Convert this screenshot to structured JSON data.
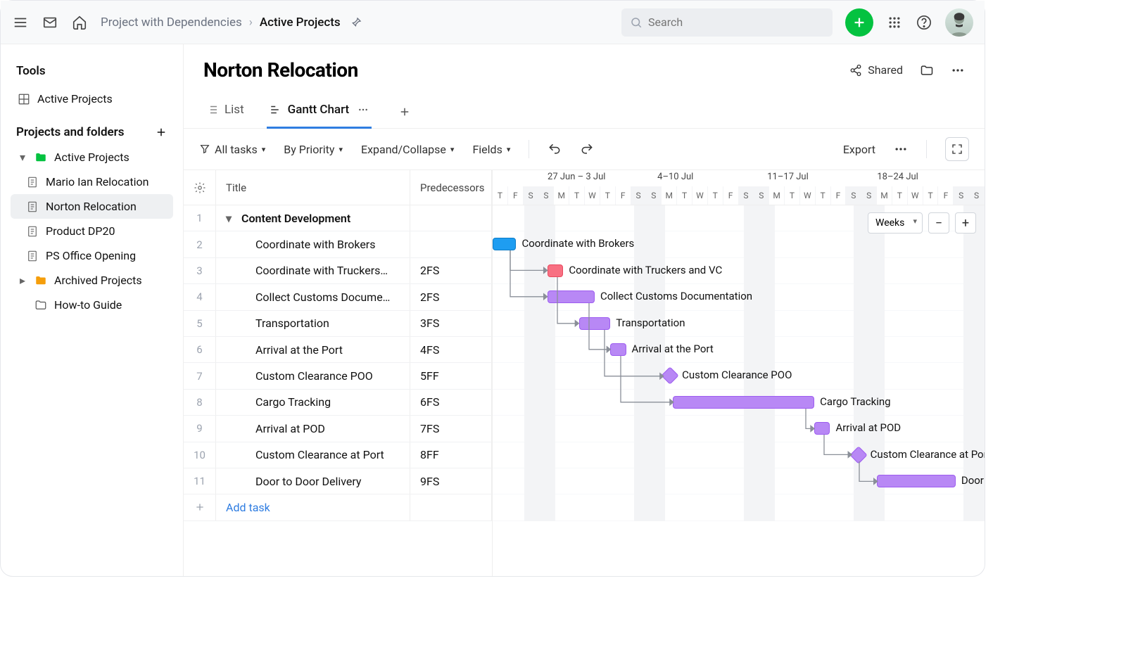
{
  "topbar": {
    "breadcrumb_parent": "Project with Dependencies",
    "breadcrumb_current": "Active Projects",
    "search_placeholder": "Search"
  },
  "sidebar": {
    "tools_header": "Tools",
    "tools_item": "Active Projects",
    "projects_header": "Projects and folders",
    "items": [
      {
        "label": "Active Projects",
        "type": "folder-green",
        "expanded": true
      },
      {
        "label": "Mario Ian Relocation",
        "type": "doc",
        "child": true
      },
      {
        "label": "Norton Relocation",
        "type": "doc",
        "child": true,
        "selected": true
      },
      {
        "label": "Product DP20",
        "type": "doc",
        "child": true
      },
      {
        "label": "PS Office Opening",
        "type": "doc",
        "child": true
      },
      {
        "label": "Archived Projects",
        "type": "folder-orange",
        "collapsed": true
      },
      {
        "label": "How-to Guide",
        "type": "folder-plain"
      }
    ]
  },
  "header": {
    "title": "Norton Relocation",
    "shared_label": "Shared",
    "tabs": {
      "list": "List",
      "gantt": "Gantt Chart"
    }
  },
  "toolbar": {
    "all_tasks": "All tasks",
    "by_priority": "By Priority",
    "expand": "Expand/Collapse",
    "fields": "Fields",
    "export": "Export"
  },
  "grid": {
    "col_title": "Title",
    "col_pred": "Predecessors",
    "add_task": "Add task",
    "rows": [
      {
        "n": "1",
        "title": "Content Development",
        "pred": "",
        "group": true
      },
      {
        "n": "2",
        "title": "Coordinate with Brokers",
        "pred": ""
      },
      {
        "n": "3",
        "title": "Coordinate with Truckers…",
        "pred": "2FS"
      },
      {
        "n": "4",
        "title": "Collect Customs Docume…",
        "pred": "2FS"
      },
      {
        "n": "5",
        "title": "Transportation",
        "pred": "3FS"
      },
      {
        "n": "6",
        "title": "Arrival at the Port",
        "pred": "4FS"
      },
      {
        "n": "7",
        "title": "Custom Clearance POO",
        "pred": "5FF"
      },
      {
        "n": "8",
        "title": "Cargo Tracking",
        "pred": "6FS"
      },
      {
        "n": "9",
        "title": "Arrival at POD",
        "pred": "7FS"
      },
      {
        "n": "10",
        "title": "Custom Clearance at Port",
        "pred": "8FF"
      },
      {
        "n": "11",
        "title": "Door to Door Delivery",
        "pred": "9FS"
      }
    ]
  },
  "timeline": {
    "weeks": [
      "27 Jun – 3 Jul",
      "4–10 Jul",
      "11–17 Jul",
      "18–24 Jul"
    ],
    "zoom_label": "Weeks",
    "bars": [
      {
        "row": 2,
        "label": "Coordinate with Brokers",
        "color": "blue",
        "start": 0,
        "dur": 1.5
      },
      {
        "row": 3,
        "label": "Coordinate with Truckers and VC",
        "color": "red",
        "start": 3.5,
        "dur": 1
      },
      {
        "row": 4,
        "label": "Collect Customs Documentation",
        "color": "purple",
        "start": 3.5,
        "dur": 3
      },
      {
        "row": 5,
        "label": "Transportation",
        "color": "purple",
        "start": 5.5,
        "dur": 2
      },
      {
        "row": 6,
        "label": "Arrival at the Port",
        "color": "purple",
        "start": 7.5,
        "dur": 1
      },
      {
        "row": 7,
        "label": "Custom Clearance POO",
        "color": "purple",
        "milestone": true,
        "start": 10.9
      },
      {
        "row": 8,
        "label": "Cargo Tracking",
        "color": "purple",
        "start": 11.5,
        "dur": 9
      },
      {
        "row": 9,
        "label": "Arrival at POD",
        "color": "purple",
        "start": 20.5,
        "dur": 1
      },
      {
        "row": 10,
        "label": "Custom Clearance at Port",
        "color": "purple",
        "milestone": true,
        "start": 22.9
      },
      {
        "row": 11,
        "label": "Door to Door Delivery",
        "color": "purple",
        "start": 24.5,
        "dur": 5
      }
    ]
  }
}
